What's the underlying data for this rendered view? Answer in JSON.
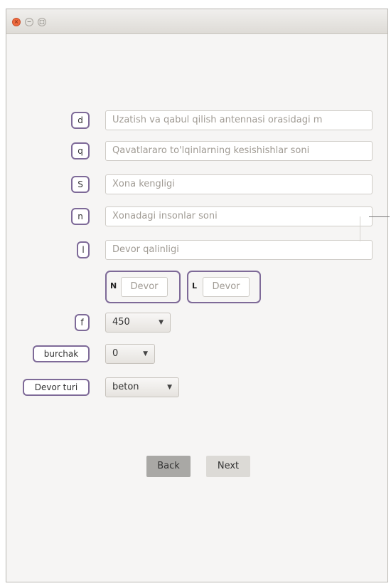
{
  "window": {
    "buttons": {
      "close": "×",
      "minimize": "−",
      "maximize": "□"
    }
  },
  "fields": [
    {
      "label": "d",
      "placeholder": "Uzatish va qabul qilish antennasi orasidagi m"
    },
    {
      "label": "q",
      "placeholder": "Qavatlararo to'lqinlarning kesishishlar soni"
    },
    {
      "label": "S",
      "placeholder": "Xona kengligi"
    },
    {
      "label": "n",
      "placeholder": "Xonadagi insonlar soni"
    },
    {
      "label": "l",
      "placeholder": "Devor qalinligi"
    }
  ],
  "wall_group": [
    {
      "label": "N",
      "placeholder": "Devor"
    },
    {
      "label": "L",
      "placeholder": "Devor"
    }
  ],
  "selects": [
    {
      "label": "f",
      "value": "450"
    },
    {
      "label": "burchak",
      "value": "0"
    },
    {
      "label": "Devor turi",
      "value": "beton"
    }
  ],
  "buttons": {
    "back": "Back",
    "next": "Next"
  },
  "colors": {
    "label_border": "#7e6a98",
    "close_button": "#ef6a3e",
    "back_button": "#a9a8a5"
  }
}
